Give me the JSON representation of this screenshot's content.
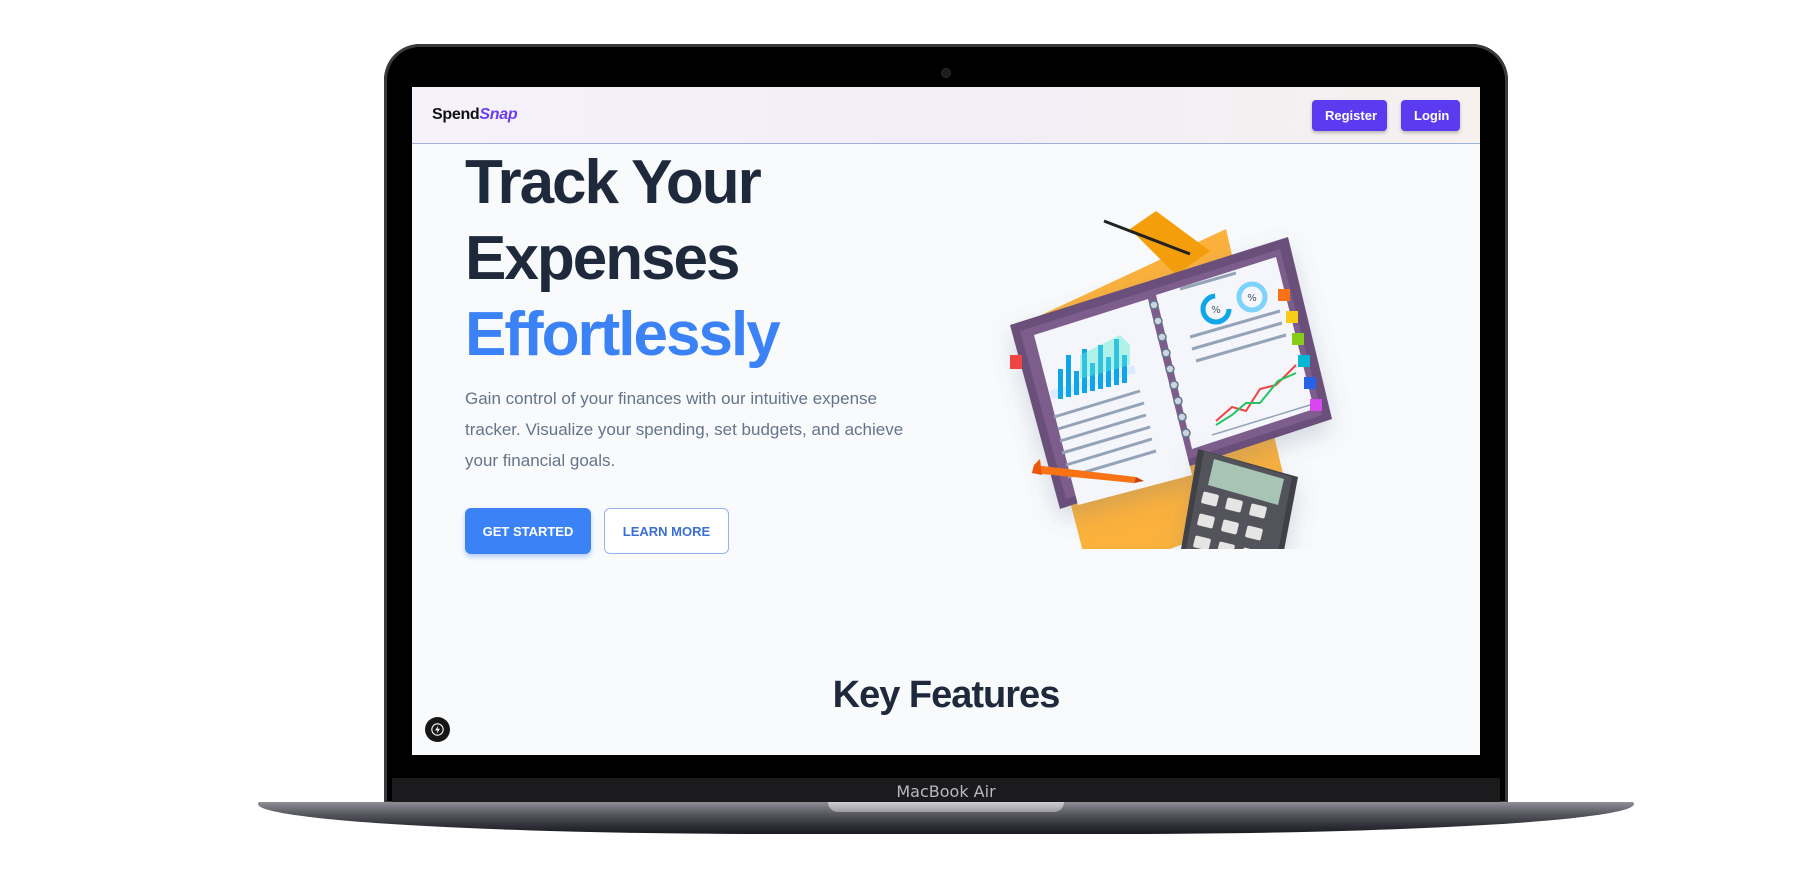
{
  "device": {
    "label": "MacBook Air"
  },
  "nav": {
    "brand_part1": "Spend",
    "brand_part2": "Snap",
    "register_label": "Register",
    "login_label": "Login"
  },
  "hero": {
    "title_line1": "Track Your",
    "title_line2": "Expenses",
    "title_accent": "Effortlessly",
    "subtitle": "Gain control of your finances with our intuitive expense tracker. Visualize your spending, set budgets, and achieve your financial goals.",
    "primary_cta": "GET STARTED",
    "secondary_cta": "LEARN MORE",
    "illustration": "notebook-calculator-illustration"
  },
  "features": {
    "title": "Key Features"
  },
  "colors": {
    "accent": "#3b82f6",
    "brand": "#5b3bf0",
    "heading": "#1e293b"
  },
  "icons": {
    "fab": "lightning-icon"
  }
}
